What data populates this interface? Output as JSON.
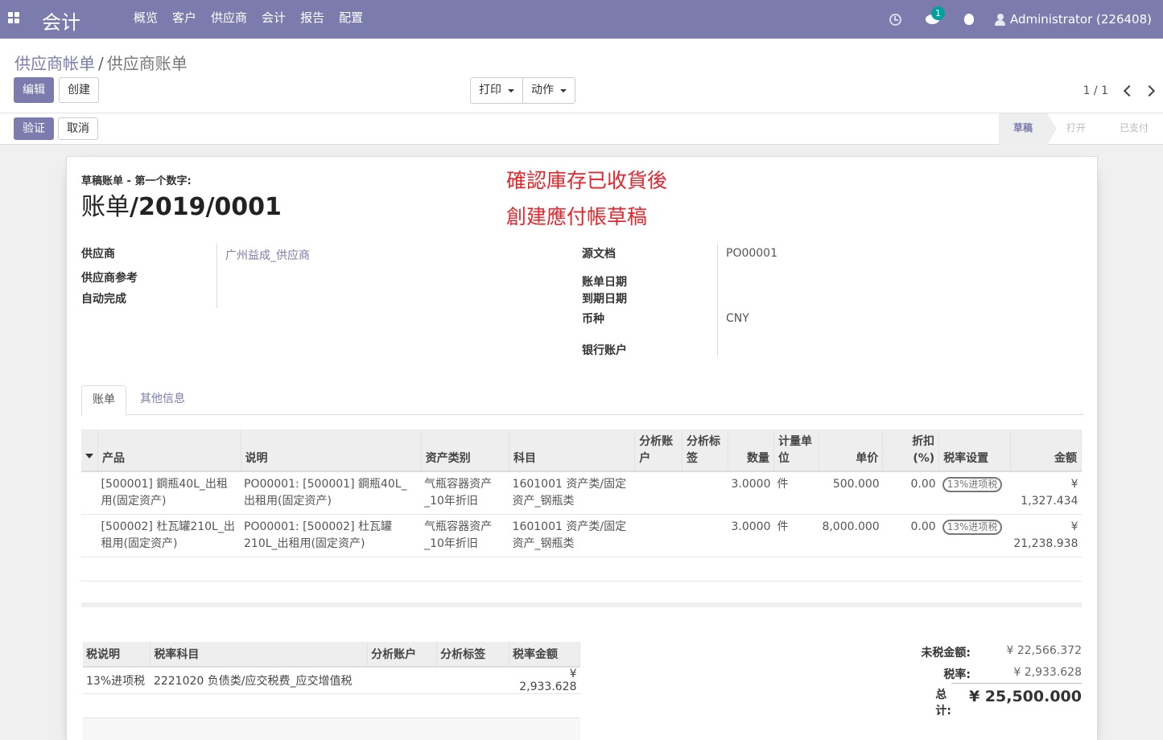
{
  "topbar": {
    "app_name": "会计",
    "menu": [
      "概览",
      "客户",
      "供应商",
      "会计",
      "报告",
      "配置"
    ],
    "chat_badge": "1",
    "user": "Administrator (226408)"
  },
  "control": {
    "breadcrumb_parent": "供应商帐单",
    "breadcrumb_sep": "/",
    "breadcrumb_current": "供应商账单",
    "edit_label": "编辑",
    "create_label": "创建",
    "print_label": "打印",
    "action_label": "动作",
    "pager": "1 / 1",
    "validate_label": "验证",
    "cancel_label": "取消",
    "stages": [
      "草稿",
      "打开",
      "已支付"
    ]
  },
  "sheet": {
    "draft_label": "草稿账单 - 第一个数字:",
    "title_prefix": "账单",
    "title_number": "/2019/0001",
    "annotation_line1": "確認庫存已收貨後",
    "annotation_line2": "創建應付帳草稿"
  },
  "fields": {
    "vendor_label": "供应商",
    "vendor_value": "广州益成_供应商",
    "vendor_ref_label": "供应商参考",
    "auto_complete_label": "自动完成",
    "source_label": "源文档",
    "source_value": "PO00001",
    "bill_date_label": "账单日期",
    "due_date_label": "到期日期",
    "currency_label": "币种",
    "currency_value": "CNY",
    "bank_label": "银行账户"
  },
  "tabs": [
    "账单",
    "其他信息"
  ],
  "lines": {
    "headers": [
      "产品",
      "说明",
      "资产类别",
      "科目",
      "分析账户",
      "分析标签",
      "数量",
      "计量单位",
      "单价",
      "折扣 (%)",
      "税率设置",
      "金额"
    ],
    "rows": [
      {
        "product": "[500001] 鋼瓶40L_出租用(固定资产)",
        "desc": "PO00001: [500001] 鋼瓶40L_出租用(固定资产)",
        "asset": "气瓶容器资产_10年折旧",
        "account": "1601001 资产类/固定资产_钢瓶类",
        "qty": "3.0000",
        "uom": "件",
        "price": "500.000",
        "discount": "0.00",
        "tax": "13%进项税",
        "amount": "¥ 1,327.434"
      },
      {
        "product": "[500002] 杜瓦罐210L_出租用(固定资产)",
        "desc": "PO00001: [500002] 杜瓦罐210L_出租用(固定资产)",
        "asset": "气瓶容器资产_10年折旧",
        "account": "1601001 资产类/固定资产_钢瓶类",
        "qty": "3.0000",
        "uom": "件",
        "price": "8,000.000",
        "discount": "0.00",
        "tax": "13%进项税",
        "amount": "¥ 21,238.938"
      }
    ]
  },
  "taxes": {
    "headers": [
      "税说明",
      "税率科目",
      "分析账户",
      "分析标签",
      "税率金额"
    ],
    "rows": [
      {
        "name": "13%进项税",
        "account": "2221020 负债类/应交税费_应交增值税",
        "analytic": "",
        "tags": "",
        "amount": "¥ 2,933.628"
      }
    ]
  },
  "totals": {
    "untaxed_label": "未税金额:",
    "untaxed_value": "¥ 22,566.372",
    "tax_label": "税率:",
    "tax_value": "¥ 2,933.628",
    "total_label": "总计:",
    "total_value": "¥ 25,500.000"
  },
  "colors": {
    "brand": "#7c7bad",
    "annotation": "#e4262c",
    "badge": "#00a09d"
  }
}
